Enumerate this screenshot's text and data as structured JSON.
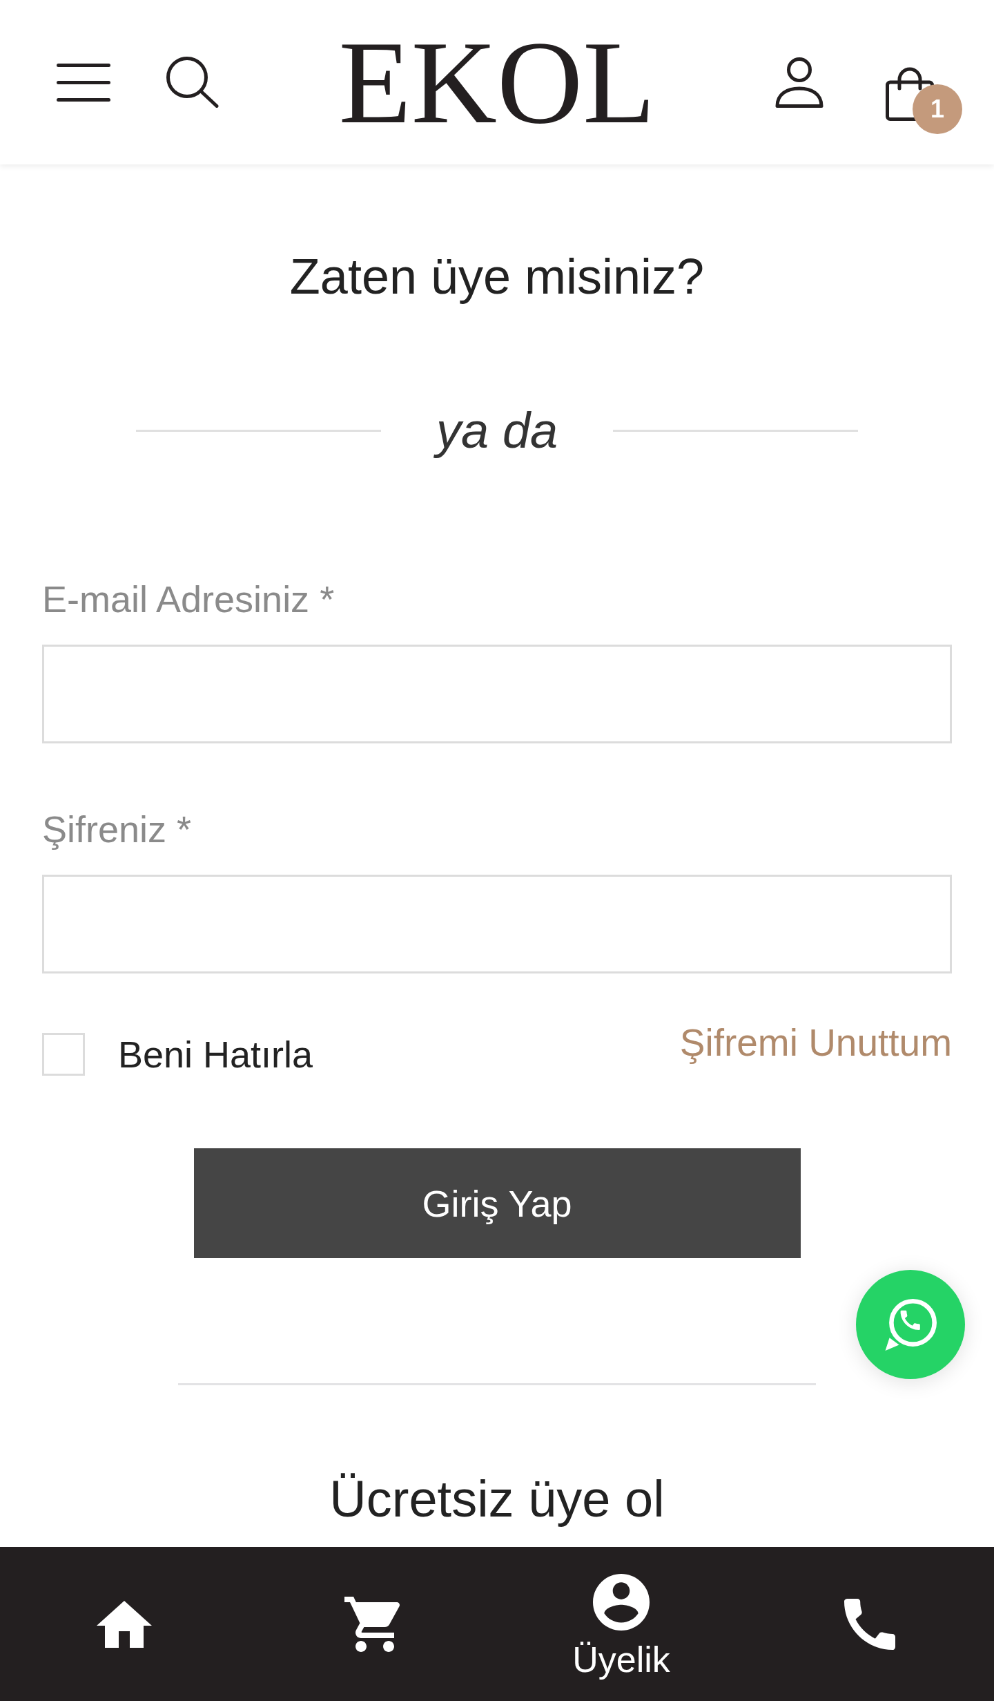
{
  "header": {
    "logo": "EKOL",
    "cart_count": "1"
  },
  "login": {
    "title": "Zaten üye misiniz?",
    "separator": "ya da",
    "fields": [
      {
        "label": "E-mail Adresiniz *"
      },
      {
        "label": "Şifreniz *"
      }
    ],
    "remember": {
      "label": "Beni Hatırla",
      "checked": false
    },
    "forgot_link": "Şifremi Unuttum",
    "submit": "Giriş Yap"
  },
  "register": {
    "title": "Ücretsiz üye ol"
  },
  "bottom_nav": {
    "items": [
      {
        "selected": false
      },
      {
        "selected": false
      },
      {
        "selected": true,
        "label": "Üyelik"
      },
      {
        "selected": false
      }
    ]
  }
}
